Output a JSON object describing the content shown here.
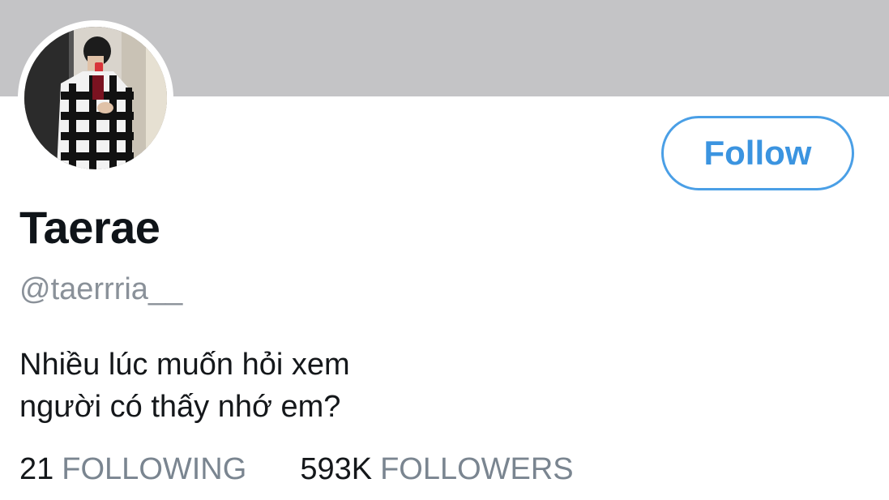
{
  "profile": {
    "display_name": "Taerae",
    "handle": "@taerrria__",
    "bio_lines": [
      "Nhiều lúc muốn hỏi xem",
      "người có thấy nhớ em?"
    ],
    "follow_label": "Follow"
  },
  "stats": {
    "following_count": "21",
    "following_label": "FOLLOWING",
    "followers_count": "593K",
    "followers_label": "FOLLOWERS"
  },
  "colors": {
    "banner": "#c4c4c6",
    "accent": "#4a9fe6",
    "secondary_text": "#8a9199"
  }
}
